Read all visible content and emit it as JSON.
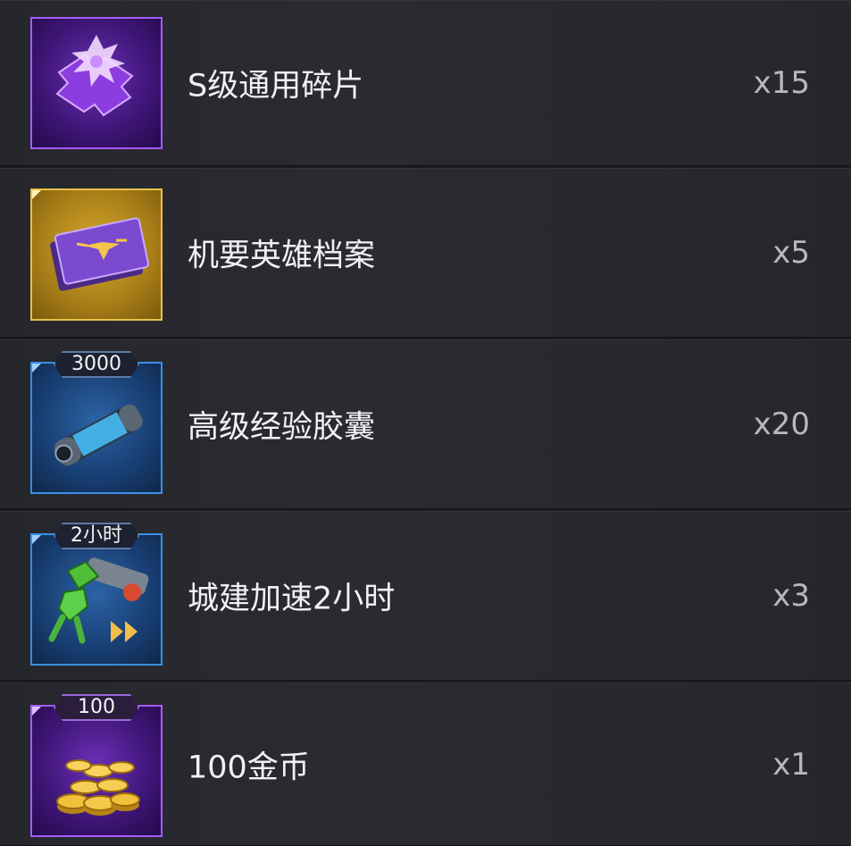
{
  "rewards": [
    {
      "name": "S级通用碎片",
      "qty": "x15",
      "icon": "purple-puzzle-piece-icon",
      "rarity_color": "#a45cff",
      "badge": ""
    },
    {
      "name": "机要英雄档案",
      "qty": "x5",
      "icon": "hero-file-card-icon",
      "rarity_color": "#e7c24a",
      "badge": ""
    },
    {
      "name": "高级经验胶囊",
      "qty": "x20",
      "icon": "exp-capsule-icon",
      "rarity_color": "#3b8fe6",
      "badge": "3000"
    },
    {
      "name": "城建加速2小时",
      "qty": "x3",
      "icon": "construction-speedup-icon",
      "rarity_color": "#3b8fe6",
      "badge": "2小时"
    },
    {
      "name": "100金币",
      "qty": "x1",
      "icon": "gold-coins-icon",
      "rarity_color": "#a45cff",
      "badge": "100"
    }
  ]
}
